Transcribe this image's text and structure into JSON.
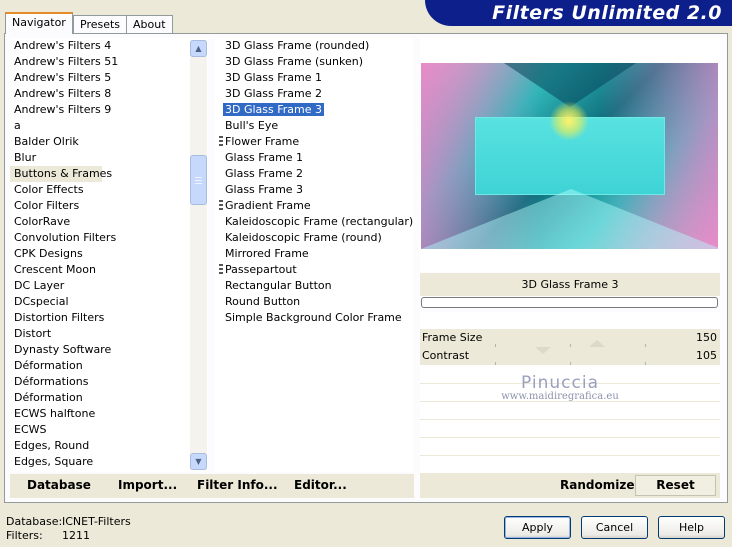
{
  "tabs": [
    "Navigator",
    "Presets",
    "About"
  ],
  "banner": {
    "title": "Filters Unlimited 2.0"
  },
  "categories": {
    "items": [
      "Andrew's Filters 4",
      "Andrew's Filters 51",
      "Andrew's Filters 5",
      "Andrew's Filters 8",
      "Andrew's Filters 9",
      "a",
      "Balder Olrik",
      "Blur",
      "Buttons & Frames",
      "Color Effects",
      "Color Filters",
      "ColorRave",
      "Convolution Filters",
      "CPK Designs",
      "Crescent Moon",
      "DC Layer",
      "DCspecial",
      "Distortion Filters",
      "Distort",
      "Dynasty Software",
      "Déformation",
      "Déformations",
      "Déformation",
      "ECWS halftone",
      "ECWS",
      "Edges, Round",
      "Edges, Square"
    ],
    "selected": "Buttons & Frames"
  },
  "effects": {
    "items": [
      "3D Glass Frame (rounded)",
      "3D Glass Frame (sunken)",
      "3D Glass Frame 1",
      "3D Glass Frame 2",
      "3D Glass Frame 3",
      "Bull's Eye",
      "Flower Frame",
      "Glass Frame 1",
      "Glass Frame 2",
      "Glass Frame 3",
      "Gradient Frame",
      "Kaleidoscopic Frame (rectangular)",
      "Kaleidoscopic Frame (round)",
      "Mirrored Frame",
      "Passepartout",
      "Rectangular Button",
      "Round Button",
      "Simple Background Color Frame"
    ],
    "selected": "3D Glass Frame 3",
    "marked": [
      "Flower Frame",
      "Gradient Frame",
      "Passepartout"
    ]
  },
  "preview": {
    "effect_name": "3D Glass Frame 3",
    "progress": 0
  },
  "sliders": [
    {
      "label": "Frame Size",
      "value": "150",
      "fraction": 0.59
    },
    {
      "label": "Contrast",
      "value": "105",
      "fraction": 0.41
    }
  ],
  "watermark": {
    "name": "Pinuccia",
    "url": "www.maidiregrafica.eu"
  },
  "toolbar": {
    "database": "Database",
    "import": "Import...",
    "filter_info": "Filter Info...",
    "editor": "Editor...",
    "randomize": "Randomize",
    "reset": "Reset"
  },
  "status": {
    "database_label": "Database:",
    "database_value": "ICNET-Filters",
    "filters_label": "Filters:",
    "filters_value": "1211"
  },
  "buttons": {
    "apply": "Apply",
    "cancel": "Cancel",
    "help": "Help"
  }
}
